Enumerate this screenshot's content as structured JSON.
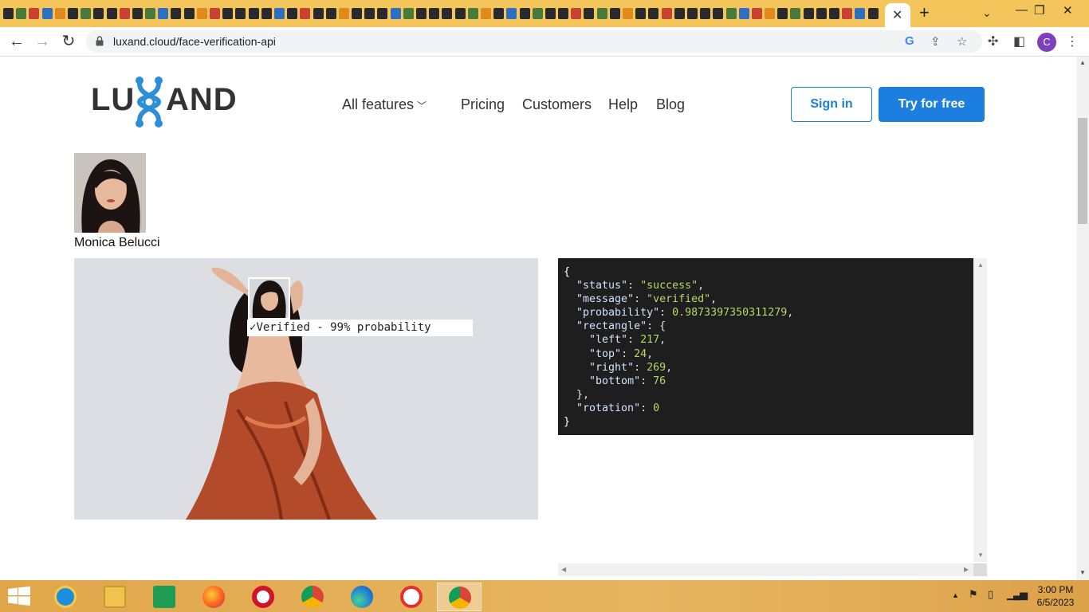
{
  "browser": {
    "tab_close": "✕",
    "new_tab": "+",
    "url": "luxand.cloud/face-verification-api",
    "profile_initial": "C"
  },
  "site": {
    "logo_text_left": "LU",
    "logo_text_right": "AND",
    "nav": {
      "all_features": "All features",
      "pricing": "Pricing",
      "customers": "Customers",
      "help": "Help",
      "blog": "Blog"
    },
    "sign_in": "Sign in",
    "try_free": "Try for free"
  },
  "verification": {
    "person_name": "Monica Belucci",
    "badge": "Verified - 99% probability",
    "badge_icon": "checkmark-icon"
  },
  "response": {
    "status": "\"success\"",
    "message": "\"verified\"",
    "probability": "0.9873397350311279",
    "left": "217",
    "top": "24",
    "right": "269",
    "bottom": "76",
    "rotation": "0"
  },
  "taskbar": {
    "time": "3:00 PM",
    "date": "6/5/2023"
  },
  "colors": {
    "accent": "#1c7fe0",
    "tabstrip": "#f4c55a",
    "code_bg": "#1e1e1e"
  }
}
